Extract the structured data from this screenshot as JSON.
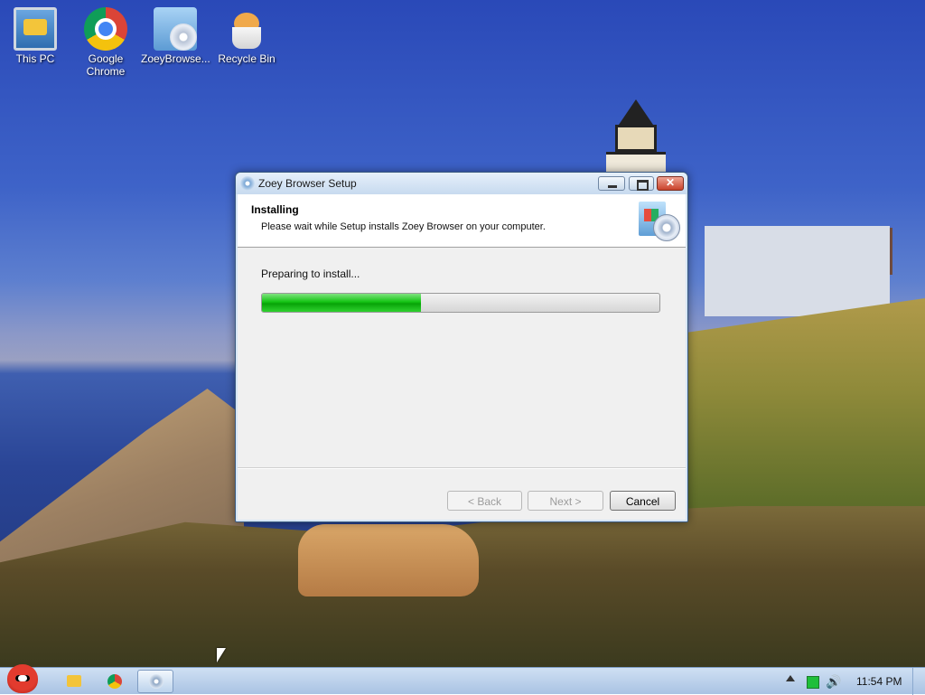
{
  "desktop": {
    "icons": [
      {
        "label": "This PC"
      },
      {
        "label": "Google Chrome"
      },
      {
        "label": "ZoeyBrowse..."
      },
      {
        "label": "Recycle Bin"
      }
    ]
  },
  "window": {
    "title": "Zoey Browser Setup",
    "close_glyph": "✕",
    "header": {
      "title": "Installing",
      "subtitle": "Please wait while Setup installs Zoey Browser on your computer."
    },
    "status_text": "Preparing to install...",
    "progress_fraction": 0.4,
    "buttons": {
      "back": "< Back",
      "next": "Next >",
      "cancel": "Cancel"
    }
  },
  "taskbar": {
    "clock": "11:54 PM",
    "volume_glyph": "🔊"
  }
}
